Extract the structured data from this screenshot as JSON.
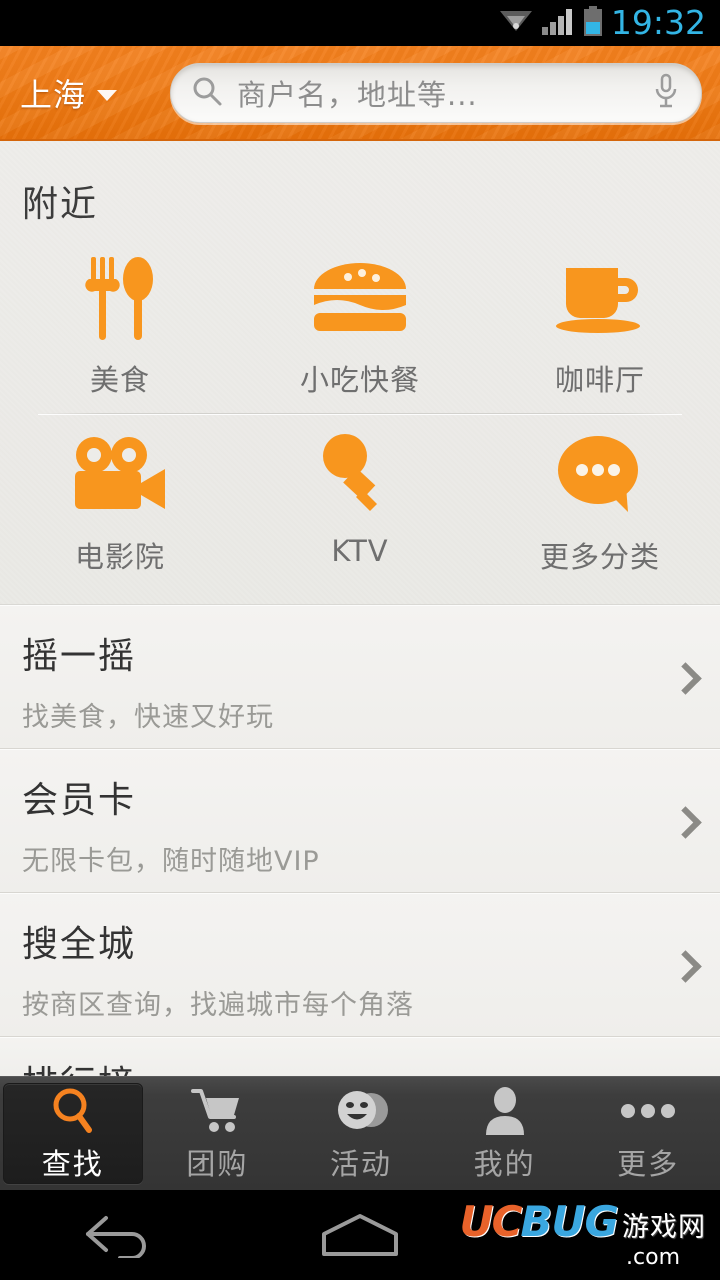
{
  "status_bar": {
    "time": "19:32",
    "icons": [
      "wifi-icon",
      "signal-icon",
      "battery-icon"
    ],
    "time_color": "#33b5e5"
  },
  "header": {
    "city": "上海",
    "city_caret": "chevron-down-icon",
    "search": {
      "placeholder": "商户名，地址等...",
      "search_icon": "search-icon",
      "voice_icon": "microphone-icon"
    },
    "accent_color": "#f58220"
  },
  "nearby": {
    "title": "附近",
    "categories": [
      {
        "label": "美食",
        "icon": "fork-spoon-icon"
      },
      {
        "label": "小吃快餐",
        "icon": "burger-icon"
      },
      {
        "label": "咖啡厅",
        "icon": "coffee-cup-icon"
      },
      {
        "label": "电影院",
        "icon": "movie-camera-icon"
      },
      {
        "label": "KTV",
        "icon": "microphone-icon"
      },
      {
        "label": "更多分类",
        "icon": "speech-bubble-dots-icon"
      }
    ]
  },
  "list": {
    "items": [
      {
        "title": "摇一摇",
        "subtitle": "找美食，快速又好玩",
        "chevron": "chevron-right-icon"
      },
      {
        "title": "会员卡",
        "subtitle": "无限卡包，随时随地VIP",
        "chevron": "chevron-right-icon"
      },
      {
        "title": "搜全城",
        "subtitle": "按商区查询，找遍城市每个角落",
        "chevron": "chevron-right-icon"
      },
      {
        "title": "排行榜",
        "subtitle": "",
        "chevron": "chevron-right-icon"
      }
    ]
  },
  "tabbar": {
    "active_index": 0,
    "active_color": "#f58220",
    "tabs": [
      {
        "label": "查找",
        "icon": "magnifier-icon"
      },
      {
        "label": "团购",
        "icon": "shopping-cart-icon"
      },
      {
        "label": "活动",
        "icon": "masks-icon"
      },
      {
        "label": "我的",
        "icon": "person-icon"
      },
      {
        "label": "更多",
        "icon": "ellipsis-icon"
      }
    ]
  },
  "navbar": {
    "back": "back-arrow-icon",
    "home": "home-icon",
    "watermark": {
      "uc": "UC",
      "bug": "BUG",
      "cn": "游戏网",
      "com": ".com"
    }
  }
}
